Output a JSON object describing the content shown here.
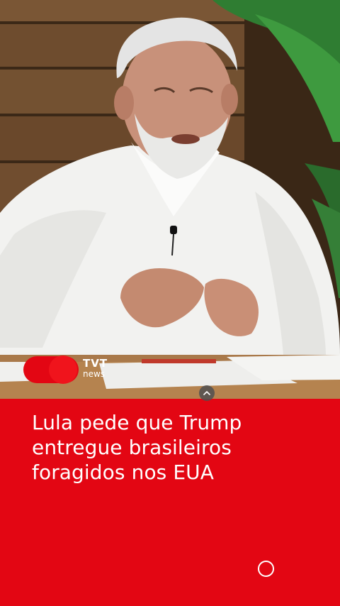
{
  "video": {
    "logo": {
      "brand": "TVT",
      "sub": "news"
    }
  },
  "headline": {
    "text": "Lula pede que Trump entregue brasileiros foragidos nos EUA"
  },
  "controls": {
    "collapse_icon": "chevron-up-icon",
    "record_icon": "circle-icon"
  },
  "colors": {
    "accent": "#e30613",
    "text": "#ffffff"
  }
}
